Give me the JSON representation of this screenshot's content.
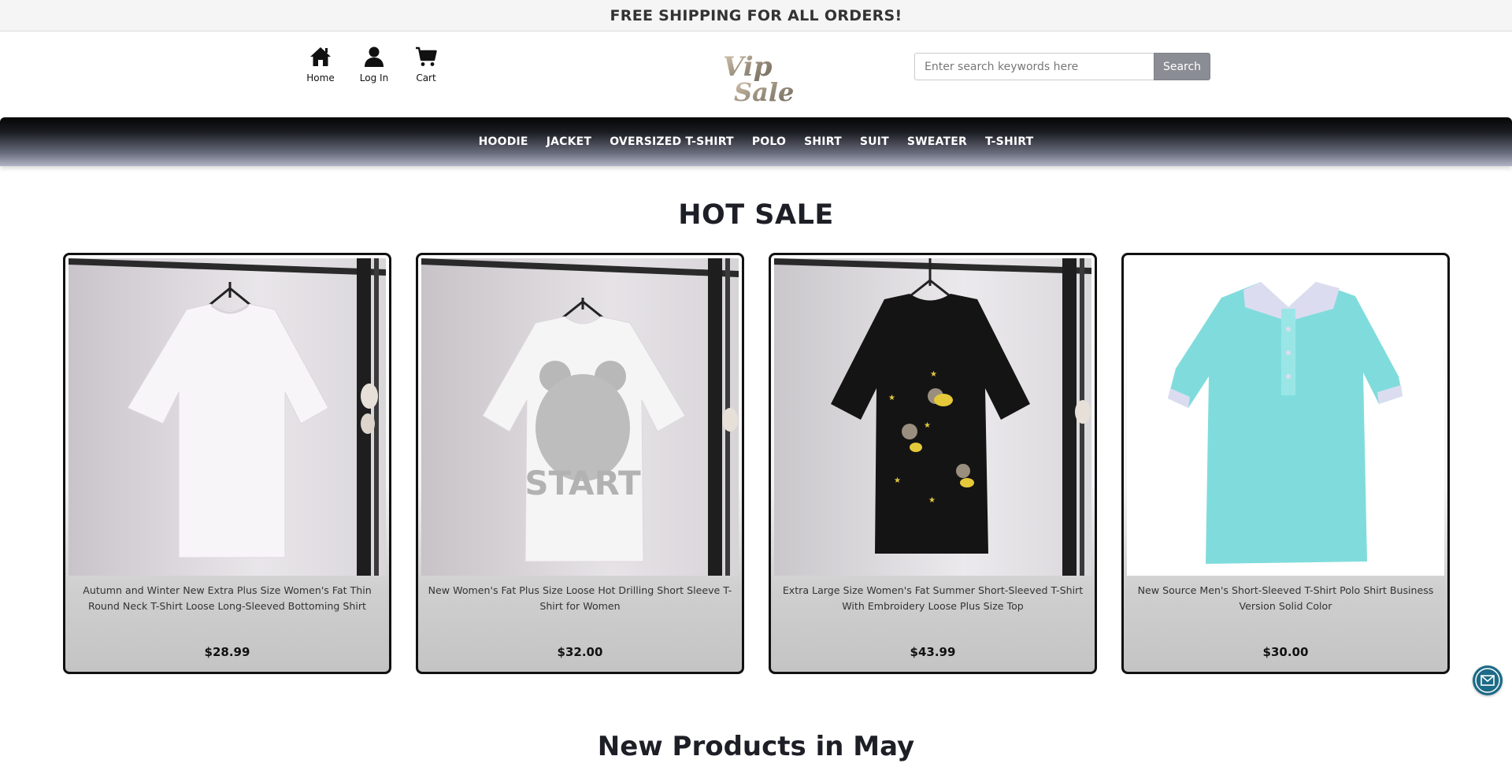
{
  "announcement": "FREE SHIPPING FOR ALL ORDERS!",
  "header": {
    "nav_icons": [
      {
        "label": "Home",
        "icon": "home-icon"
      },
      {
        "label": "Log In",
        "icon": "user-icon"
      },
      {
        "label": "Cart",
        "icon": "cart-icon"
      }
    ],
    "logo_alt": "Vip Sale",
    "search": {
      "placeholder": "Enter search keywords here",
      "button_label": "Search"
    }
  },
  "categories": [
    "HOODIE",
    "JACKET",
    "OVERSIZED T-SHIRT",
    "POLO",
    "SHIRT",
    "SUIT",
    "SWEATER",
    "T-SHIRT"
  ],
  "hot_sale": {
    "title": "HOT SALE",
    "products": [
      {
        "name": "Autumn and Winter New Extra Plus Size Women's Fat Thin Round Neck T-Shirt Loose Long-Sleeved Bottoming Shirt",
        "price": "$28.99",
        "image": "white-tshirt-on-hanger"
      },
      {
        "name": "New Women's Fat Plus Size Loose Hot Drilling Short Sleeve T-Shirt for Women",
        "price": "$32.00",
        "image": "white-bear-start-tshirt"
      },
      {
        "name": "Extra Large Size Women's Fat Summer Short-Sleeved T-Shirt With Embroidery Loose Plus Size Top",
        "price": "$43.99",
        "image": "black-mouse-embroidery-tshirt"
      },
      {
        "name": "New Source Men's Short-Sleeved T-Shirt Polo Shirt Business Version Solid Color",
        "price": "$30.00",
        "image": "aqua-polo-shirt"
      }
    ]
  },
  "new_products": {
    "title": "New Products in May"
  },
  "colors": {
    "accent_nav_dark": "#050505",
    "search_button": "#8a8d94",
    "mail_button": "#1c6b87"
  }
}
